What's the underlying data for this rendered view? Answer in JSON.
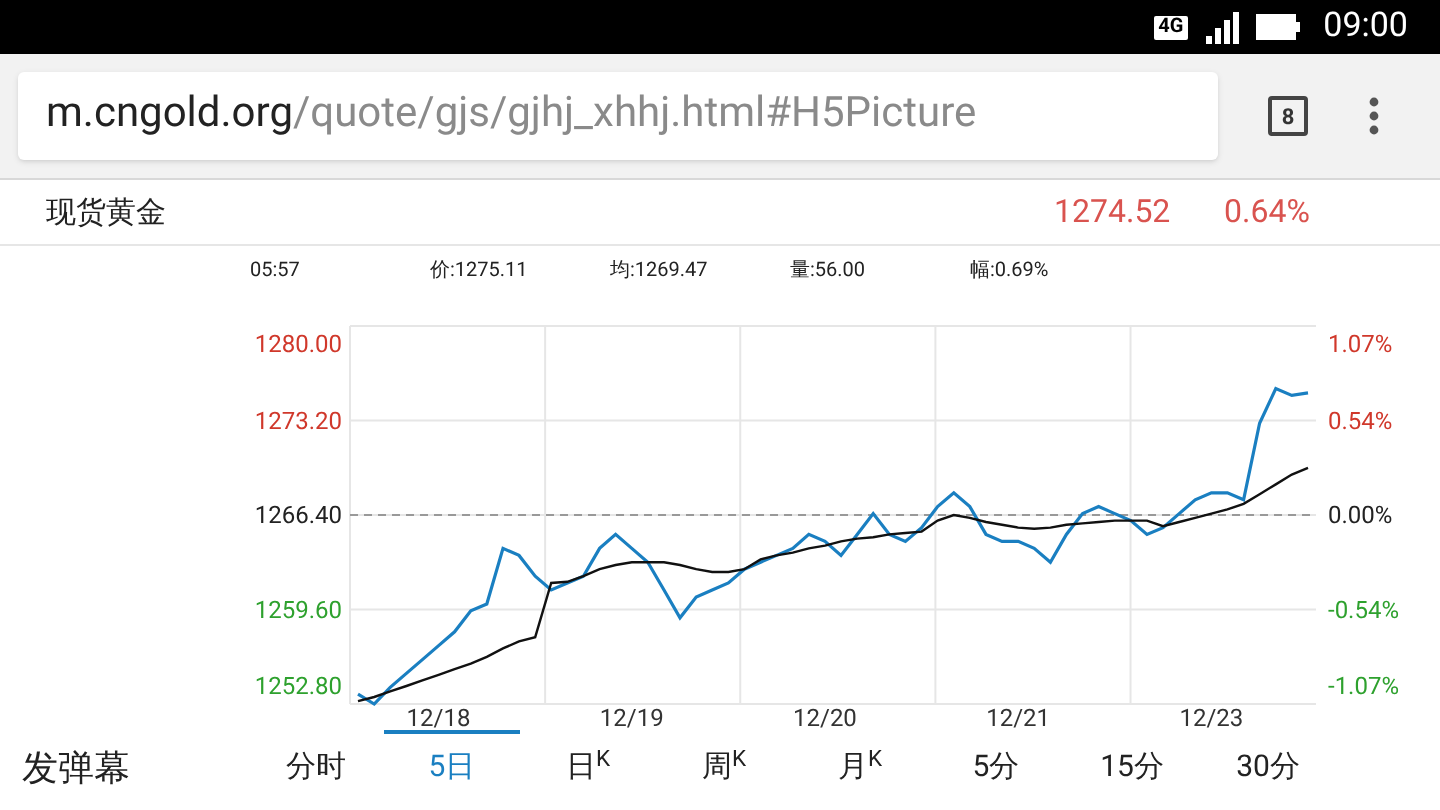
{
  "status_bar": {
    "network": "4G",
    "time": "09:00"
  },
  "browser": {
    "url_host": "m.cngold.org",
    "url_path": "/quote/gjs/gjhj_xhhj.html#H5Picture",
    "tab_count": "8"
  },
  "quote": {
    "name": "现货黄金",
    "price": "1274.52",
    "change": "0.64%"
  },
  "info": [
    "05:57",
    "价:1275.11",
    "均:1269.47",
    "量:56.00",
    "幅:0.69%"
  ],
  "chart": {
    "percent_labels": [
      {
        "text": "1.07%",
        "color": "#d0382b"
      },
      {
        "text": "0.54%",
        "color": "#d0382b"
      },
      {
        "text": "0.00%",
        "color": "#222222"
      },
      {
        "text": "-0.54%",
        "color": "#2ea12e"
      },
      {
        "text": "-1.07%",
        "color": "#2ea12e"
      }
    ],
    "chart_data": {
      "type": "line",
      "grid": true,
      "ref_lines": [
        {
          "axis": "y",
          "value": 1266.4
        }
      ],
      "categories": [
        null,
        null,
        null,
        null,
        null,
        "12/18",
        null,
        null,
        null,
        null,
        null,
        null,
        null,
        null,
        null,
        null,
        null,
        "12/19",
        null,
        null,
        null,
        null,
        null,
        null,
        null,
        null,
        null,
        null,
        null,
        "12/20",
        null,
        null,
        null,
        null,
        null,
        null,
        null,
        null,
        null,
        null,
        null,
        "12/21",
        null,
        null,
        null,
        null,
        null,
        null,
        null,
        null,
        null,
        null,
        null,
        "12/23",
        null,
        null,
        null,
        null,
        null,
        null
      ],
      "ylim": [
        1252.8,
        1280
      ],
      "yticks": [
        {
          "value": 1280,
          "label": "1280.00"
        },
        {
          "value": 1273.2,
          "label": "1273.20"
        },
        {
          "value": 1266.4,
          "label": "1266.40"
        },
        {
          "value": 1259.6,
          "label": "1259.60"
        },
        {
          "value": 1252.8,
          "label": "1252.80"
        }
      ],
      "series": [
        {
          "color": "#1a7fc1",
          "values": [
            1253.5,
            1252.8,
            1254,
            1255,
            1256,
            1257,
            1258,
            1259.5,
            1260,
            1264,
            1263.5,
            1262,
            1261,
            1261.5,
            1262,
            1264,
            1265,
            1264,
            1263,
            1261,
            1259,
            1260.5,
            1261,
            1261.5,
            1262.5,
            1263,
            1263.5,
            1264,
            1265,
            1264.5,
            1263.5,
            1265,
            1266.5,
            1265,
            1264.5,
            1265.5,
            1267,
            1268,
            1267,
            1265,
            1264.5,
            1264.5,
            1264,
            1263,
            1265,
            1266.5,
            1267,
            1266.5,
            1266,
            1265,
            1265.5,
            1266.5,
            1267.5,
            1268,
            1268,
            1267.5,
            1273,
            1275.5,
            1275,
            1275.2
          ]
        },
        {
          "color": "#111111",
          "values": [
            1253,
            1253.3,
            1253.7,
            1254.1,
            1254.5,
            1254.9,
            1255.3,
            1255.7,
            1256.2,
            1256.8,
            1257.3,
            1257.6,
            1261.5,
            1261.6,
            1262,
            1262.5,
            1262.8,
            1263,
            1263,
            1263,
            1262.8,
            1262.5,
            1262.3,
            1262.3,
            1262.5,
            1263.2,
            1263.5,
            1263.7,
            1264,
            1264.2,
            1264.5,
            1264.7,
            1264.8,
            1265,
            1265.1,
            1265.2,
            1266,
            1266.4,
            1266.2,
            1265.9,
            1265.7,
            1265.5,
            1265.4,
            1265.5,
            1265.7,
            1265.8,
            1265.9,
            1266,
            1266,
            1266,
            1265.6,
            1265.9,
            1266.2,
            1266.5,
            1266.8,
            1267.2,
            1267.9,
            1268.6,
            1269.3,
            1269.8
          ]
        }
      ]
    }
  },
  "danmaku_button": "发弹幕",
  "tabs": [
    {
      "label": "分时",
      "selected": false
    },
    {
      "label": "5日",
      "selected": true
    },
    {
      "label": "日$^{K}$",
      "selected": false
    },
    {
      "label": "周$^{K}$",
      "selected": false
    },
    {
      "label": "月$^{K}$",
      "selected": false
    },
    {
      "label": "5分",
      "selected": false
    },
    {
      "label": "15分",
      "selected": false
    },
    {
      "label": "30分",
      "selected": false
    }
  ]
}
